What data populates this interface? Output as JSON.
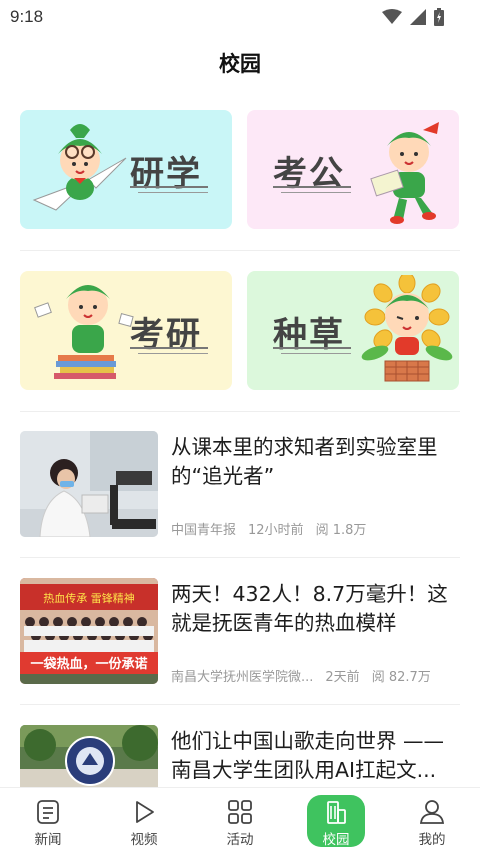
{
  "status": {
    "time": "9:18"
  },
  "page": {
    "title": "校园"
  },
  "cards": [
    {
      "label": "研学",
      "bg": "#c9f6f7"
    },
    {
      "label": "考公",
      "bg": "#fde8f7"
    },
    {
      "label": "考研",
      "bg": "#fdf7d2"
    },
    {
      "label": "种草",
      "bg": "#dcf8dc"
    }
  ],
  "news": [
    {
      "title": "从课本里的求知者到实验室里的“追光者”",
      "source": "中国青年报",
      "time": "12小时前",
      "views_prefix": "阅",
      "views": "1.8万",
      "thumb_banner": ""
    },
    {
      "title": "两天！432人！8.7万毫升！这就是抚医青年的热血模样",
      "source": "南昌大学抚州医学院微...",
      "time": "2天前",
      "views_prefix": "阅",
      "views": "82.7万",
      "thumb_banner": "热血传承 雷锋精神",
      "thumb_slogan": "一袋热血，一份承诺"
    },
    {
      "title": "他们让中国山歌走向世界 ——南昌大学生团队用AI扛起文...",
      "source": "",
      "time": "",
      "views_prefix": "",
      "views": ""
    }
  ],
  "nav": [
    {
      "label": "新闻",
      "icon": "news-icon"
    },
    {
      "label": "视频",
      "icon": "video-icon"
    },
    {
      "label": "活动",
      "icon": "activity-icon"
    },
    {
      "label": "校园",
      "icon": "campus-icon",
      "active": true
    },
    {
      "label": "我的",
      "icon": "profile-icon"
    }
  ],
  "colors": {
    "accent": "#3fc35f"
  }
}
